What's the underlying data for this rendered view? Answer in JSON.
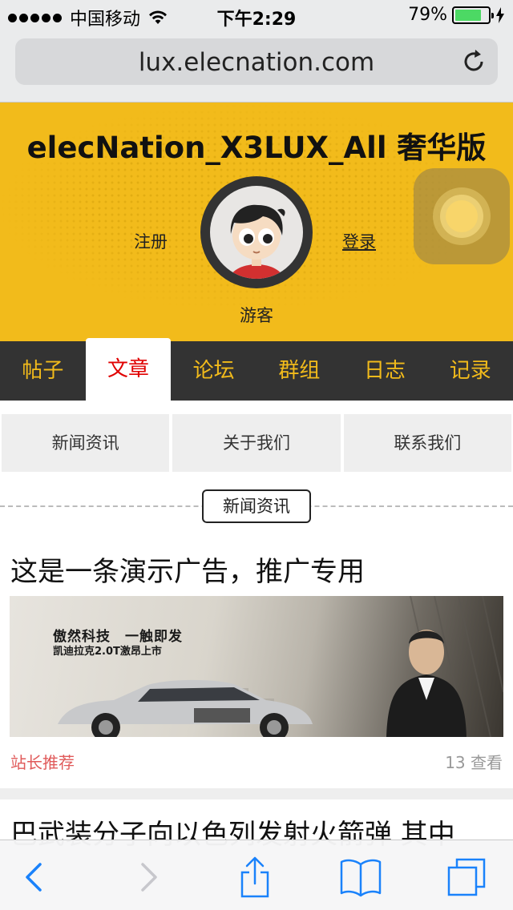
{
  "status_bar": {
    "carrier": "中国移动",
    "time": "下午2:29",
    "battery": "79%",
    "battery_level": 0.79
  },
  "browser": {
    "url": "lux.elecnation.com"
  },
  "header": {
    "title": "elecNation_X3LUX_All 奢华版",
    "register": "注册",
    "login": "登录",
    "guest": "游客"
  },
  "main_nav": {
    "items": [
      {
        "label": "帖子"
      },
      {
        "label": "文章"
      },
      {
        "label": "论坛"
      },
      {
        "label": "群组"
      },
      {
        "label": "日志"
      },
      {
        "label": "记录"
      }
    ],
    "active": "文章"
  },
  "sub_tabs": [
    {
      "label": "新闻资讯"
    },
    {
      "label": "关于我们"
    },
    {
      "label": "联系我们"
    }
  ],
  "section_label": "新闻资讯",
  "articles": [
    {
      "title": "这是一条演示广告，推广专用",
      "banner_line1": "傲然科技　一触即发",
      "banner_line2": "凯迪拉克2.0T激昂上市",
      "source": "站长推荐",
      "views": "13 查看"
    },
    {
      "title": "巴武装分子向以色列发射火箭弹 其中"
    }
  ],
  "colors": {
    "header_yellow": "#f2bb1b",
    "nav_dark": "#333333",
    "active_red": "#e00000",
    "ios_blue": "#1a82fb"
  },
  "icons": {
    "back": "chevron-left-icon",
    "forward": "chevron-right-icon",
    "share": "share-icon",
    "bookmarks": "book-icon",
    "tabs": "tabs-icon",
    "reload": "reload-icon"
  }
}
